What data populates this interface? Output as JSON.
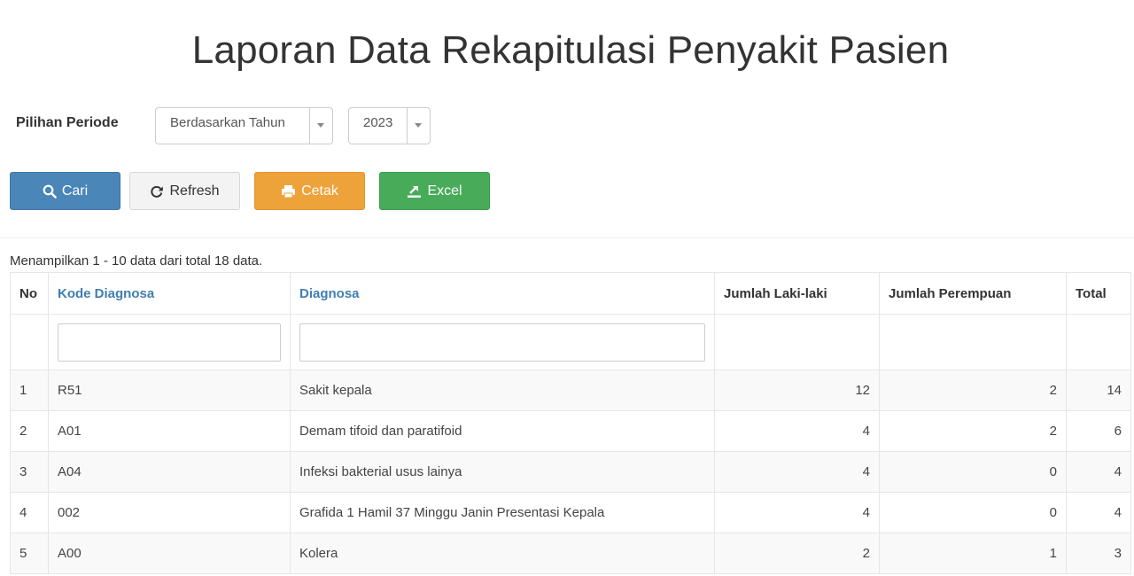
{
  "page": {
    "title": "Laporan Data Rekapitulasi Penyakit Pasien"
  },
  "filters": {
    "period_label": "Pilihan Periode",
    "period_type": "Berdasarkan Tahun",
    "year": "2023"
  },
  "buttons": {
    "search": "Cari",
    "refresh": "Refresh",
    "print": "Cetak",
    "excel": "Excel"
  },
  "colors": {
    "search": "#4a86b8",
    "print": "#eea23a",
    "excel": "#47ab5a",
    "link_header": "#3f7fb1"
  },
  "table": {
    "summary": "Menampilkan 1 - 10 data dari total 18 data.",
    "headers": {
      "no": "No",
      "code": "Kode Diagnosa",
      "diagnosis": "Diagnosa",
      "male": "Jumlah Laki-laki",
      "female": "Jumlah Perempuan",
      "total": "Total"
    },
    "filters": {
      "code": "",
      "diagnosis": ""
    },
    "rows": [
      {
        "no": "1",
        "code": "R51",
        "diagnosis": "Sakit kepala",
        "male": "12",
        "female": "2",
        "total": "14"
      },
      {
        "no": "2",
        "code": "A01",
        "diagnosis": "Demam tifoid dan paratifoid",
        "male": "4",
        "female": "2",
        "total": "6"
      },
      {
        "no": "3",
        "code": "A04",
        "diagnosis": "Infeksi bakterial usus lainya",
        "male": "4",
        "female": "0",
        "total": "4"
      },
      {
        "no": "4",
        "code": "002",
        "diagnosis": "Grafida 1 Hamil 37 Minggu Janin Presentasi Kepala",
        "male": "4",
        "female": "0",
        "total": "4"
      },
      {
        "no": "5",
        "code": "A00",
        "diagnosis": "Kolera",
        "male": "2",
        "female": "1",
        "total": "3"
      }
    ]
  }
}
